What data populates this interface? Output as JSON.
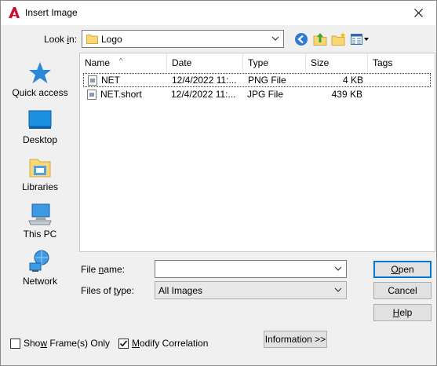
{
  "window": {
    "title": "Insert Image",
    "app_icon": "autocad-a-icon",
    "close_icon": "close-icon"
  },
  "lookin": {
    "label_pre": "Look ",
    "label_key": "i",
    "label_post": "n:",
    "value": "Logo"
  },
  "toolbar": {
    "icons": [
      "back-icon",
      "up-folder-icon",
      "new-folder-icon",
      "views-menu-icon"
    ]
  },
  "places": [
    {
      "label": "Quick access",
      "icon": "quick-access-star-icon"
    },
    {
      "label": "Desktop",
      "icon": "desktop-icon"
    },
    {
      "label": "Libraries",
      "icon": "libraries-icon"
    },
    {
      "label": "This PC",
      "icon": "this-pc-icon"
    },
    {
      "label": "Network",
      "icon": "network-icon"
    }
  ],
  "filelist": {
    "columns": [
      "Name",
      "Date",
      "Type",
      "Size",
      "Tags"
    ],
    "rows": [
      {
        "name": "NET",
        "date": "12/4/2022 11:...",
        "type": "PNG File",
        "size": "4 KB",
        "tags": "",
        "selected": true
      },
      {
        "name": "NET.short",
        "date": "12/4/2022 11:...",
        "type": "JPG File",
        "size": "439 KB",
        "tags": "",
        "selected": false
      }
    ]
  },
  "filename": {
    "label_pre": "File ",
    "label_key": "n",
    "label_post": "ame:",
    "value": ""
  },
  "filetype": {
    "label_pre": "Files of ",
    "label_key": "t",
    "label_post": "ype:",
    "value": "All Images"
  },
  "buttons": {
    "open_key": "O",
    "open_rest": "pen",
    "cancel": "Cancel",
    "help_key": "H",
    "help_rest": "elp",
    "information": "Information >>"
  },
  "options": {
    "show_frames_pre": "Sho",
    "show_frames_key": "w",
    "show_frames_post": " Frame(s) Only",
    "show_frames_checked": false,
    "modify_correlation_key": "M",
    "modify_correlation_post": "odify Correlation",
    "modify_correlation_checked": true
  },
  "colors": {
    "accent": "#0078d7",
    "app_icon_red": "#c8102e"
  }
}
